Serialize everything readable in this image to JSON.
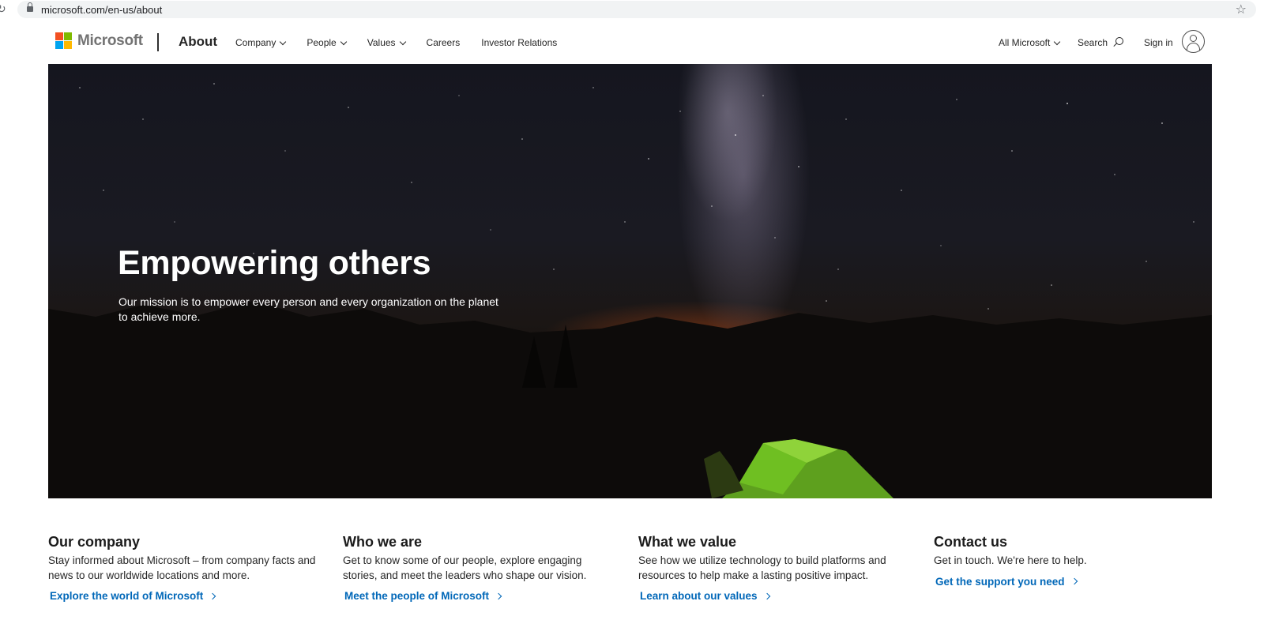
{
  "browser": {
    "url": "microsoft.com/en-us/about"
  },
  "header": {
    "brand": "Microsoft",
    "section": "About",
    "nav": [
      {
        "label": "Company",
        "has_dropdown": true
      },
      {
        "label": "People",
        "has_dropdown": true
      },
      {
        "label": "Values",
        "has_dropdown": true
      },
      {
        "label": "Careers",
        "has_dropdown": false
      },
      {
        "label": "Investor Relations",
        "has_dropdown": false
      }
    ],
    "all_microsoft": "All Microsoft",
    "search": "Search",
    "sign_in": "Sign in"
  },
  "hero": {
    "title": "Empowering others",
    "subtitle": "Our mission is to empower every person and every organization on the planet to achieve more."
  },
  "cards": [
    {
      "title": "Our company",
      "text": "Stay informed about Microsoft – from company facts and news to our worldwide locations and more.",
      "link": "Explore the world of Microsoft"
    },
    {
      "title": "Who we are",
      "text": "Get to know some of our people, explore engaging stories, and meet the leaders who shape our vision.",
      "link": "Meet the people of Microsoft"
    },
    {
      "title": "What we value",
      "text": "See how we utilize technology to build platforms and resources to help make a lasting positive impact.",
      "link": "Learn about our values"
    },
    {
      "title": "Contact us",
      "text": "Get in touch. We're here to help.",
      "link": "Get the support you need"
    }
  ],
  "colors": {
    "link": "#0067b8",
    "logo_red": "#f25022",
    "logo_green": "#7fba00",
    "logo_blue": "#00a4ef",
    "logo_yellow": "#ffb900"
  }
}
